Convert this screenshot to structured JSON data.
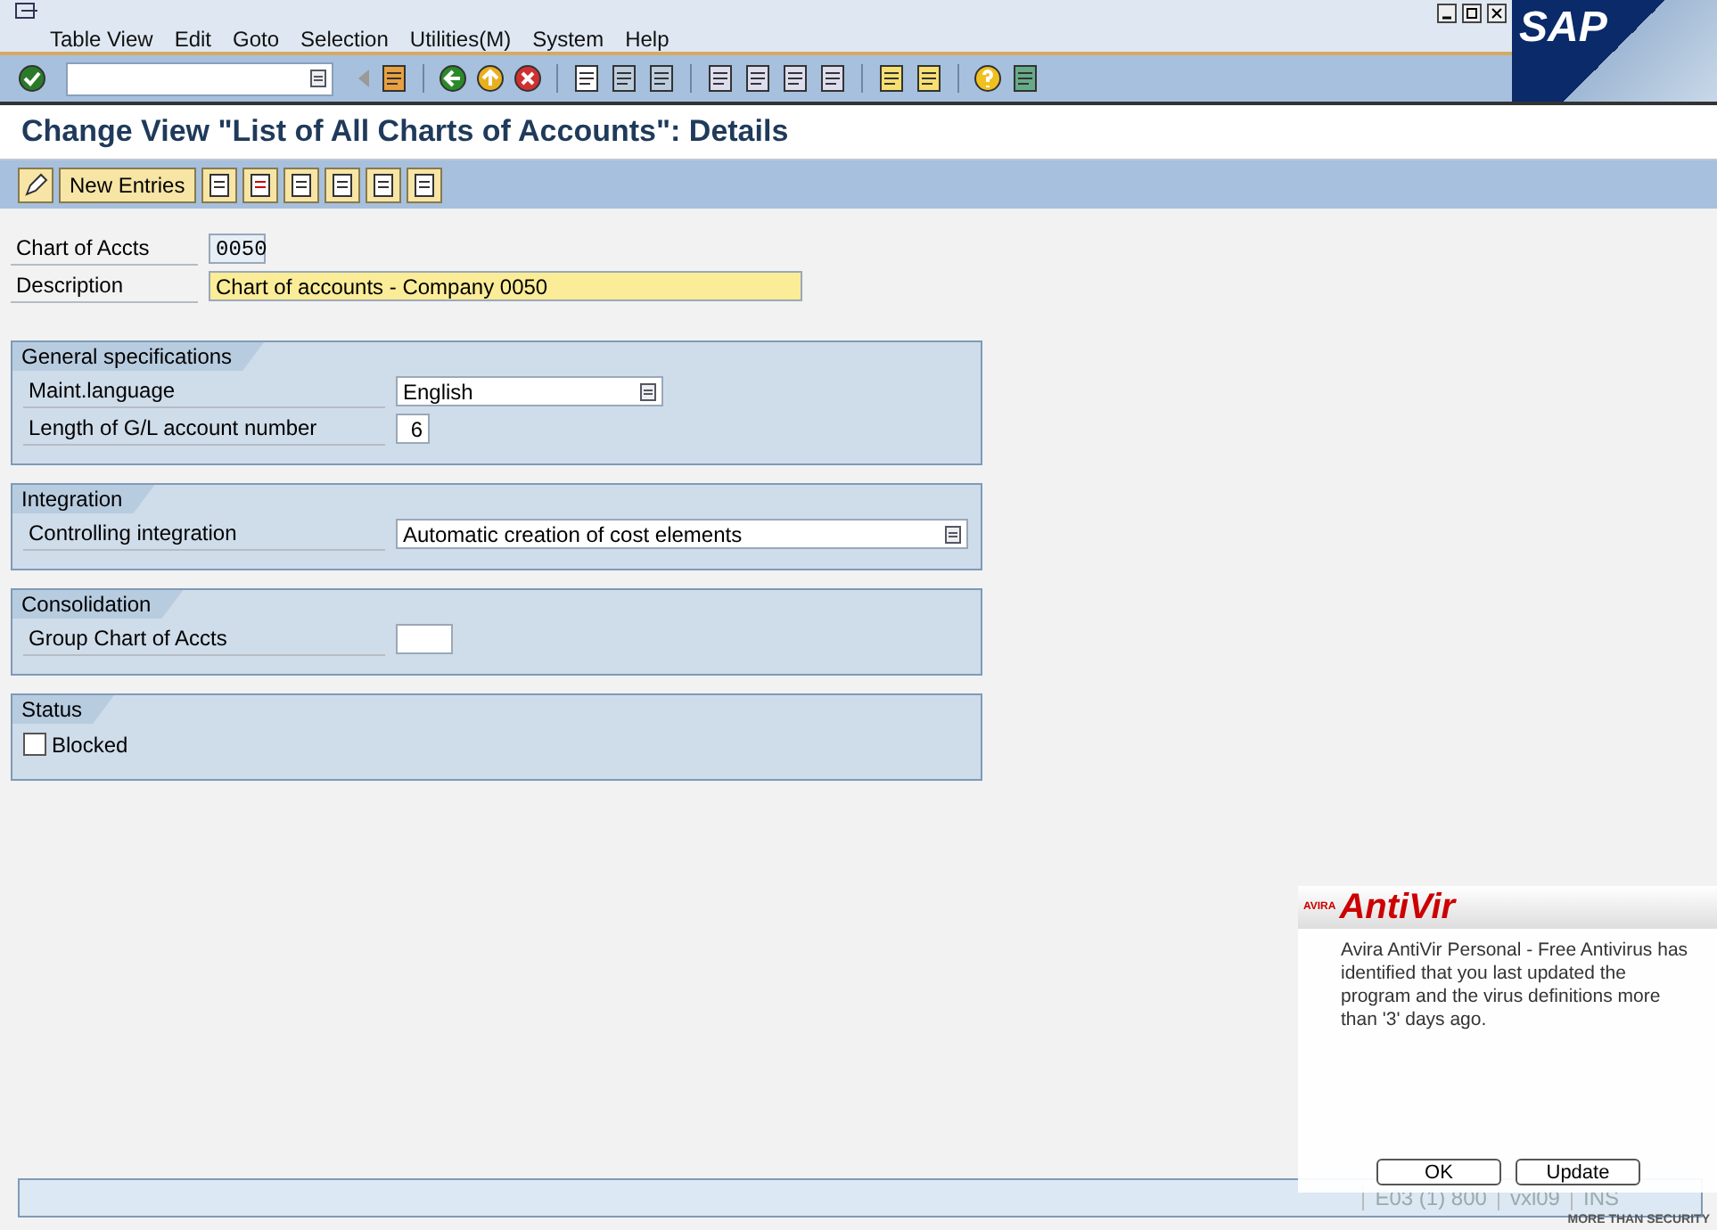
{
  "menu": [
    "Table View",
    "Edit",
    "Goto",
    "Selection",
    "Utilities(M)",
    "System",
    "Help"
  ],
  "logo": "SAP",
  "title": "Change View \"List of All Charts of Accounts\": Details",
  "app_toolbar": {
    "buttons": [
      {
        "label": "New Entries"
      }
    ]
  },
  "header_fields": [
    {
      "label": "Chart of Accts",
      "value": "0050",
      "kind": "display"
    },
    {
      "label": "Description",
      "value": "Chart of accounts - Company 0050",
      "kind": "required"
    }
  ],
  "groups": [
    {
      "title": "General specifications",
      "fields": [
        {
          "label": "Maint.language",
          "value": "English",
          "kind": "dropdown"
        },
        {
          "label": "Length of G/L account number",
          "value": "6",
          "kind": "short"
        }
      ]
    },
    {
      "title": "Integration",
      "fields": [
        {
          "label": "Controlling integration",
          "value": "Automatic creation of cost elements",
          "kind": "long_dropdown"
        }
      ]
    },
    {
      "title": "Consolidation",
      "fields": [
        {
          "label": "Group Chart of Accts",
          "kind": "short"
        }
      ]
    },
    {
      "title": "Status",
      "fields": [
        {
          "label": "Blocked",
          "kind": "checkbox",
          "checked": false
        }
      ]
    }
  ],
  "status_bar": {
    "items": [
      "E03 (1) 800",
      "vxl09",
      "INS"
    ]
  },
  "popup": {
    "brand_small": "AVIRA",
    "brand": "AntiVir",
    "message": "Avira AntiVir Personal - Free Antivirus has identified that you last updated the program and the virus definitions more than '3' days ago.",
    "buttons": [
      "OK",
      "Update"
    ],
    "tagline": "MORE THAN SECURITY"
  }
}
